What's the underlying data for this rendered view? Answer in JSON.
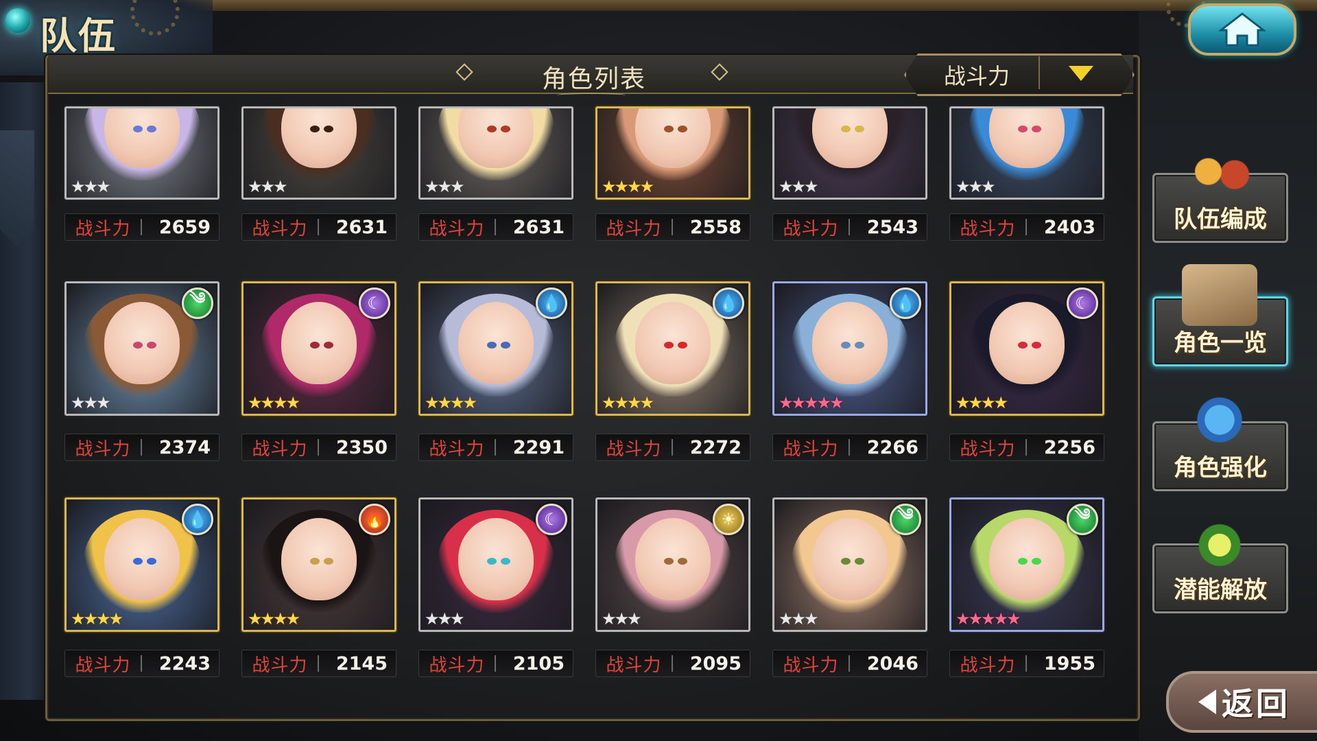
{
  "header": {
    "page_title": "队伍",
    "list_title": "角色列表",
    "sort_label": "战斗力"
  },
  "power_label": "战斗力",
  "characters": [
    {
      "power": "2659",
      "rarity": "silver",
      "stars": "★★★",
      "element": null,
      "hair": "#c8b6e6",
      "eye": "#6a7ad8",
      "bg": "#7a7f88"
    },
    {
      "power": "2631",
      "rarity": "silver",
      "stars": "★★★",
      "element": null,
      "hair": "#4a2e20",
      "eye": "#3a2010",
      "bg": "#4a4640"
    },
    {
      "power": "2631",
      "rarity": "silver",
      "stars": "★★★",
      "element": null,
      "hair": "#f2dca4",
      "eye": "#b03a2a",
      "bg": "#6a6460"
    },
    {
      "power": "2558",
      "rarity": "gold",
      "stars": "★★★★",
      "element": null,
      "hair": "#d89a76",
      "eye": "#a0502a",
      "bg": "#7a4a36"
    },
    {
      "power": "2543",
      "rarity": "silver",
      "stars": "★★★",
      "element": null,
      "hair": "#2a2028",
      "eye": "#d8b84a",
      "bg": "#4a3a52"
    },
    {
      "power": "2403",
      "rarity": "silver",
      "stars": "★★★",
      "element": null,
      "hair": "#3a8ad8",
      "eye": "#d84a6a",
      "bg": "#3a4a62"
    },
    {
      "power": "2374",
      "rarity": "silver",
      "stars": "★★★",
      "element": "wind",
      "hair": "#8a5a36",
      "eye": "#c84a6a",
      "bg": "#6a8aa8"
    },
    {
      "power": "2350",
      "rarity": "gold",
      "stars": "★★★★",
      "element": "dark",
      "hair": "#b02a6a",
      "eye": "#a02a3a",
      "bg": "#5a2a40"
    },
    {
      "power": "2291",
      "rarity": "gold",
      "stars": "★★★★",
      "element": "water",
      "hair": "#b6bcd8",
      "eye": "#4a6ab8",
      "bg": "#5a6a8a"
    },
    {
      "power": "2272",
      "rarity": "gold",
      "stars": "★★★★",
      "element": "water",
      "hair": "#f0e0b8",
      "eye": "#d82a2a",
      "bg": "#8a7a6a"
    },
    {
      "power": "2266",
      "rarity": "rainbow",
      "stars": "★★★★★",
      "element": "water",
      "hair": "#8ab0d8",
      "eye": "#6a8ab8",
      "bg": "#4a5a8a"
    },
    {
      "power": "2256",
      "rarity": "gold",
      "stars": "★★★★",
      "element": "dark",
      "hair": "#1a1a2a",
      "eye": "#d82a3a",
      "bg": "#3a2a4a"
    },
    {
      "power": "2243",
      "rarity": "gold",
      "stars": "★★★★",
      "element": "water",
      "hair": "#f0c24a",
      "eye": "#3a6ad8",
      "bg": "#4a6a9a"
    },
    {
      "power": "2145",
      "rarity": "gold",
      "stars": "★★★★",
      "element": "fire",
      "hair": "#1a1414",
      "eye": "#c8a04a",
      "bg": "#4a3a3a"
    },
    {
      "power": "2105",
      "rarity": "silver",
      "stars": "★★★",
      "element": "dark",
      "hair": "#d8304a",
      "eye": "#3ab8c8",
      "bg": "#3a2a40"
    },
    {
      "power": "2095",
      "rarity": "silver",
      "stars": "★★★",
      "element": "light",
      "hair": "#d89aa8",
      "eye": "#a06a3a",
      "bg": "#5a4a4a"
    },
    {
      "power": "2046",
      "rarity": "silver",
      "stars": "★★★",
      "element": "wind",
      "hair": "#f2c890",
      "eye": "#6a8a3a",
      "bg": "#9a7a6a"
    },
    {
      "power": "1955",
      "rarity": "rainbow",
      "stars": "★★★★★",
      "element": "wind",
      "hair": "#b8d86a",
      "eye": "#4ad84a",
      "bg": "#3a3a5a"
    }
  ],
  "element_glyphs": {
    "wind": "༄",
    "dark": "☾",
    "water": "💧",
    "fire": "🔥",
    "light": "☀"
  },
  "side_menu": [
    {
      "label": "队伍编成",
      "icon": "team-members-icon",
      "active": false
    },
    {
      "label": "角色一览",
      "icon": "open-book-icon",
      "active": true
    },
    {
      "label": "角色强化",
      "icon": "enhance-crystal-icon",
      "active": false
    },
    {
      "label": "潜能解放",
      "icon": "potential-orb-icon",
      "active": false
    }
  ],
  "back_label": "返回",
  "colors": {
    "power_label": "#e0443a",
    "sort_arrow": "#f4d12a",
    "active_outline": "#5ed6e8"
  }
}
